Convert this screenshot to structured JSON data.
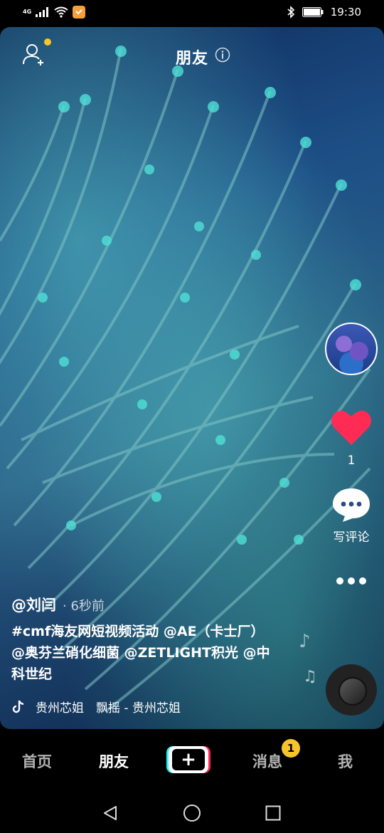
{
  "status_bar": {
    "network": "4G",
    "time": "19:30",
    "icons": [
      "signal-icon",
      "wifi-icon",
      "shield-app-icon",
      "bluetooth-icon",
      "battery-icon"
    ]
  },
  "header": {
    "title": "朋友",
    "notification_dot_color": "#f7c52b"
  },
  "right_rail": {
    "like_count": "1",
    "like_color": "#fe2c55",
    "comment_label": "写评论"
  },
  "post": {
    "author": "@刘闫",
    "time": "· 6秒前",
    "caption": "#cmf海友网短视频活动 @AE（卡士厂） @奥芬兰硝化细菌 @ZETLIGHT积光 @中科世纪",
    "music": "贵州芯姐　飘摇 - 贵州芯姐"
  },
  "bottom_nav": {
    "home": "首页",
    "friends": "朋友",
    "plus": "+",
    "messages": "消息",
    "messages_badge": "1",
    "me": "我"
  }
}
